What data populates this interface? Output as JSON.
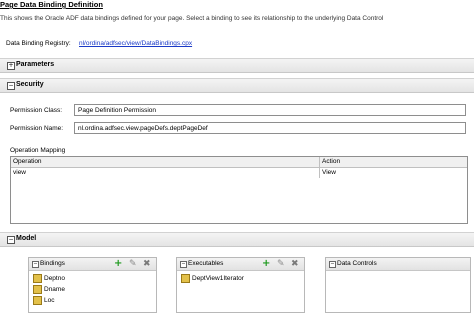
{
  "header": {
    "title": "Page Data Binding Definition",
    "description": "This shows the Oracle ADF data bindings defined for your page. Select a binding to see its relationship to the underlying Data Control"
  },
  "registry": {
    "label": "Data Binding Registry:",
    "link": "nl/ordina/adfsec/view/DataBindings.cpx"
  },
  "sections": {
    "parameters": {
      "label": "Parameters",
      "toggle": "+"
    },
    "security": {
      "label": "Security",
      "toggle": "−"
    },
    "model": {
      "label": "Model",
      "toggle": "−"
    }
  },
  "security": {
    "permission_class_label": "Permission Class:",
    "permission_class_value": "Page Definition Permission",
    "permission_name_label": "Permission Name:",
    "permission_name_value": "nl.ordina.adfsec.view.pageDefs.deptPageDef",
    "operation_mapping_label": "Operation Mapping",
    "columns": [
      "Operation",
      "Action"
    ],
    "rows": [
      {
        "operation": "view",
        "action": "View"
      }
    ]
  },
  "model": {
    "bindings": {
      "title": "Bindings",
      "items": [
        "Deptno",
        "Dname",
        "Loc"
      ]
    },
    "executables": {
      "title": "Executables",
      "items": [
        "DeptView1Iterator"
      ]
    },
    "data_controls": {
      "title": "Data Controls"
    },
    "tools": {
      "add": "+",
      "edit": "✎",
      "delete": "✖"
    }
  },
  "colors": {
    "link": "#1a39c7",
    "add": "#1e9a1e",
    "section_bg": "#e8e8e8"
  },
  "icons": {
    "binding_item": "attribute-binding-icon",
    "executable_item": "iterator-icon"
  }
}
